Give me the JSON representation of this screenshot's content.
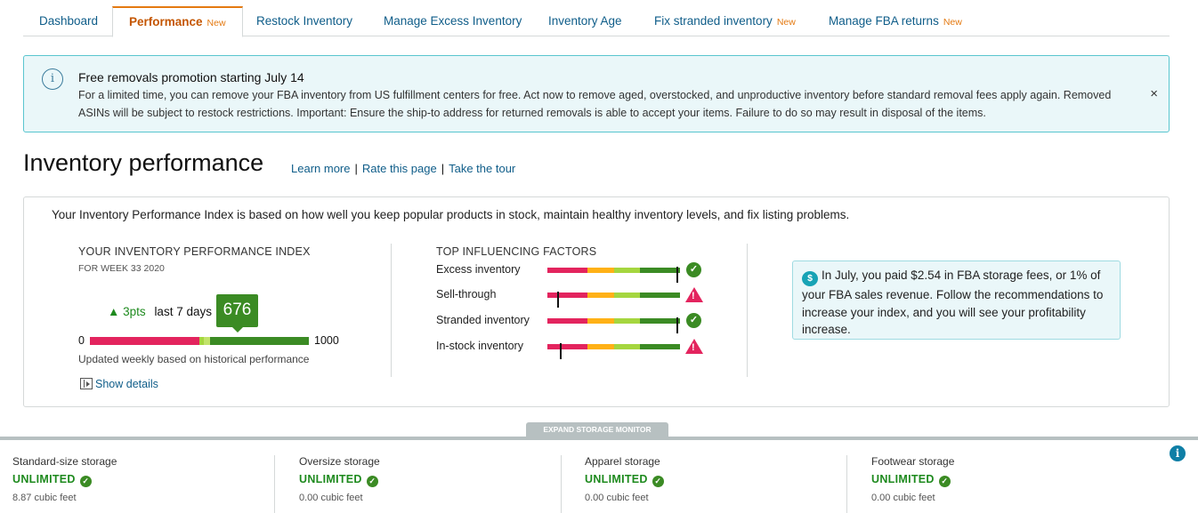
{
  "tabs": [
    {
      "label": "Dashboard",
      "badge": ""
    },
    {
      "label": "Performance",
      "badge": "New"
    },
    {
      "label": "Restock Inventory",
      "badge": ""
    },
    {
      "label": "Manage Excess Inventory",
      "badge": ""
    },
    {
      "label": "Inventory Age",
      "badge": ""
    },
    {
      "label": "Fix stranded inventory",
      "badge": "New"
    },
    {
      "label": "Manage FBA returns",
      "badge": "New"
    }
  ],
  "alert": {
    "title": "Free removals promotion starting July 14",
    "body": "For a limited time, you can remove your FBA inventory from US fulfillment centers for free. Act now to remove aged, overstocked, and unproductive inventory before standard removal fees apply again. Removed ASINs will be subject to restock restrictions. Important: Ensure the ship-to address for returned removals is able to accept your items. Failure to do so may result in disposal of the items.",
    "close": "×",
    "icon": "info-icon"
  },
  "header": {
    "title": "Inventory performance",
    "links": [
      "Learn more",
      "Rate this page",
      "Take the tour"
    ],
    "separator": "|"
  },
  "ipi": {
    "intro": "Your Inventory Performance Index is based on how well you keep popular products in stock, maintain healthy inventory levels, and fix listing problems.",
    "heading": "YOUR INVENTORY PERFORMANCE INDEX",
    "week": "FOR WEEK 33 2020",
    "delta": "3pts",
    "delta_label": "last 7 days",
    "score": "676",
    "score_value": 676,
    "min": "0",
    "max": "1000",
    "note": "Updated weekly based on historical performance",
    "show_details": "Show details"
  },
  "factors": {
    "heading": "TOP INFLUENCING FACTORS",
    "items": [
      {
        "name": "Excess inventory",
        "level": 0.98,
        "status": "ok"
      },
      {
        "name": "Sell-through",
        "level": 0.08,
        "status": "warning"
      },
      {
        "name": "Stranded inventory",
        "level": 0.98,
        "status": "ok"
      },
      {
        "name": "In-stock inventory",
        "level": 0.1,
        "status": "warning"
      }
    ]
  },
  "tip": {
    "text": "In July, you paid $2.54 in FBA storage fees, or 1% of your FBA sales revenue. Follow the recommendations to increase your index, and you will see your profitability increase.",
    "icon": "dollar-icon"
  },
  "storage": {
    "expand_label": "EXPAND STORAGE MONITOR",
    "columns": [
      {
        "name": "Standard-size storage",
        "status": "UNLIMITED",
        "size": "8.87 cubic feet"
      },
      {
        "name": "Oversize storage",
        "status": "UNLIMITED",
        "size": "0.00 cubic feet"
      },
      {
        "name": "Apparel storage",
        "status": "UNLIMITED",
        "size": "0.00 cubic feet"
      },
      {
        "name": "Footwear storage",
        "status": "UNLIMITED",
        "size": "0.00 cubic feet"
      }
    ]
  },
  "colors": {
    "red": "#e3245e",
    "orange": "#ffb116",
    "yellow_green": "#a5d63f",
    "green": "#3b8b24",
    "accent_tab": "#e47911",
    "link": "#0f5d89"
  }
}
